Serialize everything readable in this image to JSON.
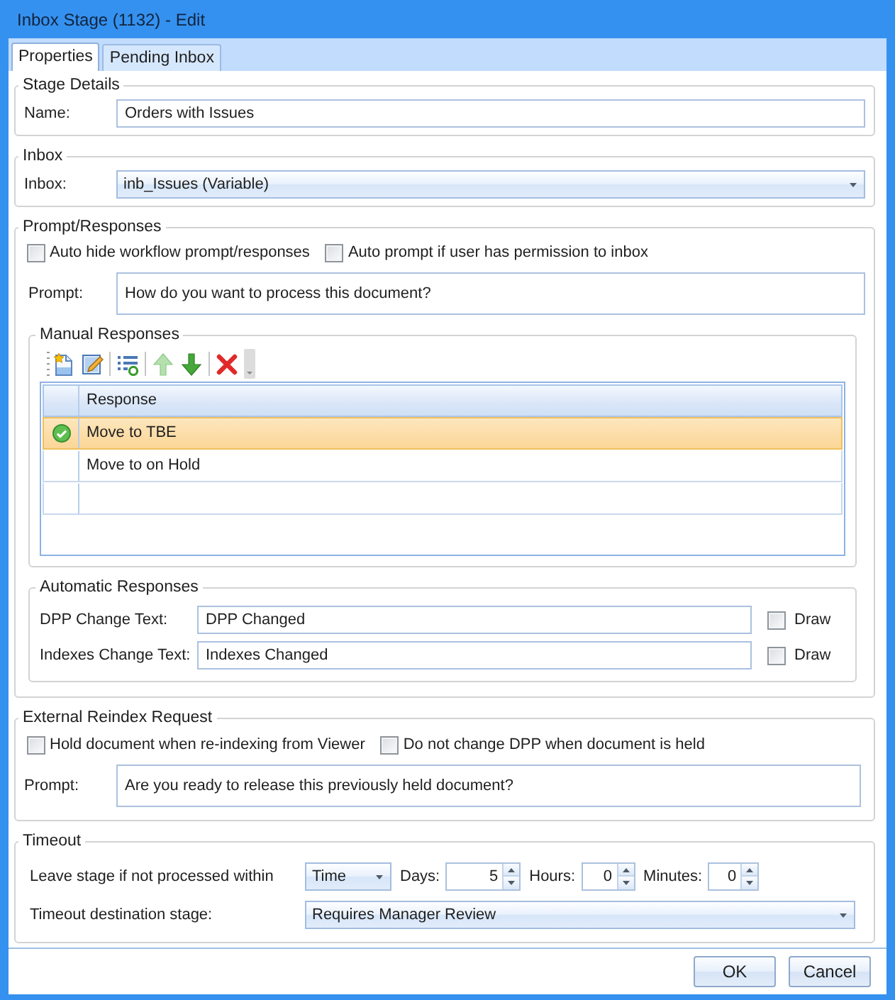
{
  "window": {
    "title": "Inbox Stage (1132) - Edit"
  },
  "tabs": [
    {
      "label": "Properties",
      "selected": true
    },
    {
      "label": "Pending Inbox",
      "selected": false
    }
  ],
  "stage_details": {
    "title": "Stage Details",
    "name_label": "Name:",
    "name_value": "Orders with Issues"
  },
  "inbox": {
    "title": "Inbox",
    "label": "Inbox:",
    "value": "inb_Issues (Variable)"
  },
  "prompt_responses": {
    "title": "Prompt/Responses",
    "options": [
      {
        "label": "Auto hide workflow prompt/responses",
        "checked": false
      },
      {
        "label": "Auto prompt if user has permission to inbox",
        "checked": false
      }
    ],
    "prompt_label": "Prompt:",
    "prompt": "How do you want to process this document?",
    "manual_responses": {
      "title": "Manual Responses",
      "toolbar": [
        [
          {
            "kind": "new",
            "disabled": false
          },
          {
            "kind": "edit",
            "disabled": false
          }
        ],
        [
          {
            "kind": "list",
            "disabled": false
          }
        ],
        [
          {
            "kind": "up",
            "disabled": true
          },
          {
            "kind": "down",
            "disabled": false
          }
        ],
        [
          {
            "kind": "delete",
            "disabled": false
          }
        ]
      ],
      "columns": [
        "Response"
      ],
      "rows": [
        {
          "response": "Move to TBE",
          "selected": true
        },
        {
          "response": "Move to on Hold",
          "selected": false
        }
      ]
    },
    "automatic_responses": {
      "title": "Automatic Responses",
      "fields": [
        {
          "label": "DPP Change Text:",
          "value": "DPP Changed",
          "draw_label": "Draw",
          "draw_checked": false
        },
        {
          "label": "Indexes Change Text:",
          "value": "Indexes Changed",
          "draw_label": "Draw",
          "draw_checked": false
        }
      ]
    }
  },
  "external_reindex": {
    "title": "External Reindex Request",
    "options": [
      {
        "label": "Hold document when re-indexing from Viewer",
        "checked": false
      },
      {
        "label": "Do not change DPP when document is held",
        "checked": false
      }
    ],
    "prompt_label": "Prompt:",
    "prompt": "Are you ready to release this previously held document?"
  },
  "timeout": {
    "title": "Timeout",
    "leave_label": "Leave stage if not processed within",
    "mode": "Time",
    "days_label": "Days:",
    "days": "5",
    "hours_label": "Hours:",
    "hours": "0",
    "minutes_label": "Minutes:",
    "minutes": "0",
    "destination_label": "Timeout destination stage:",
    "destination": "Requires Manager Review"
  },
  "buttons": [
    {
      "label": "OK"
    },
    {
      "label": "Cancel"
    }
  ]
}
